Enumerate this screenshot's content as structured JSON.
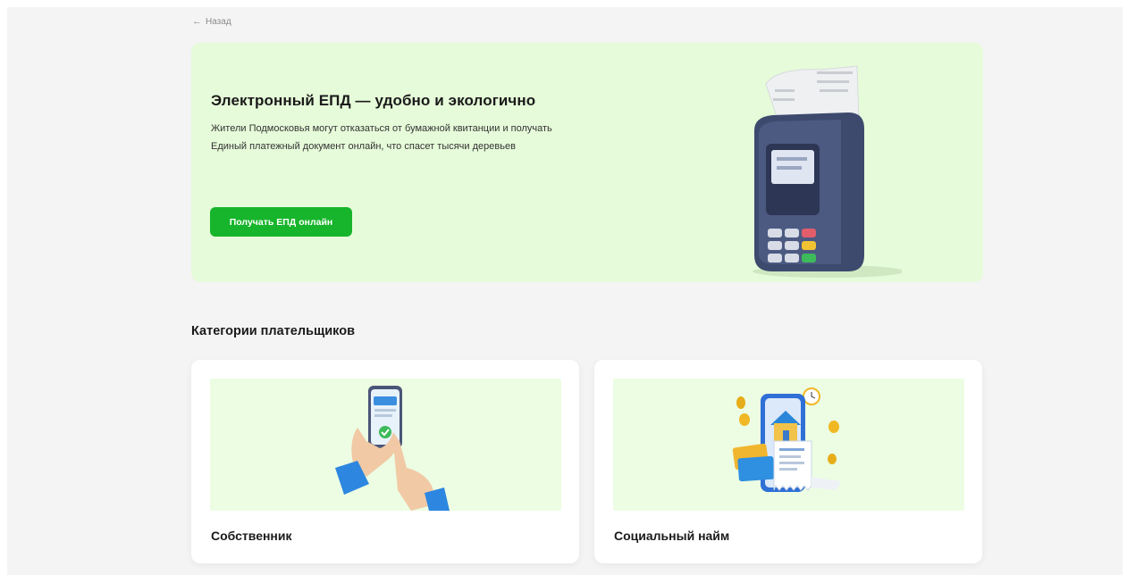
{
  "nav": {
    "back_label": "Назад",
    "back_icon": "arrow-left-icon"
  },
  "hero": {
    "title": "Электронный ЕПД — удобно и экологично",
    "description": "Жители Подмосковья могут отказаться от бумажной квитанции и получать Единый платежный документ онлайн, что спасет тысячи деревьев",
    "button_label": "Получать ЕПД онлайн",
    "illustration": "payment-terminal-icon"
  },
  "categories": {
    "title": "Категории плательщиков",
    "items": [
      {
        "label": "Собственник",
        "illustration": "hand-phone-icon"
      },
      {
        "label": "Социальный найм",
        "illustration": "phone-house-receipt-icon"
      }
    ]
  },
  "colors": {
    "accent": "#17b52b",
    "hero_bg": "#e6fbd9",
    "card_img_bg": "#ecfde3",
    "page_bg": "#f4f4f4"
  }
}
